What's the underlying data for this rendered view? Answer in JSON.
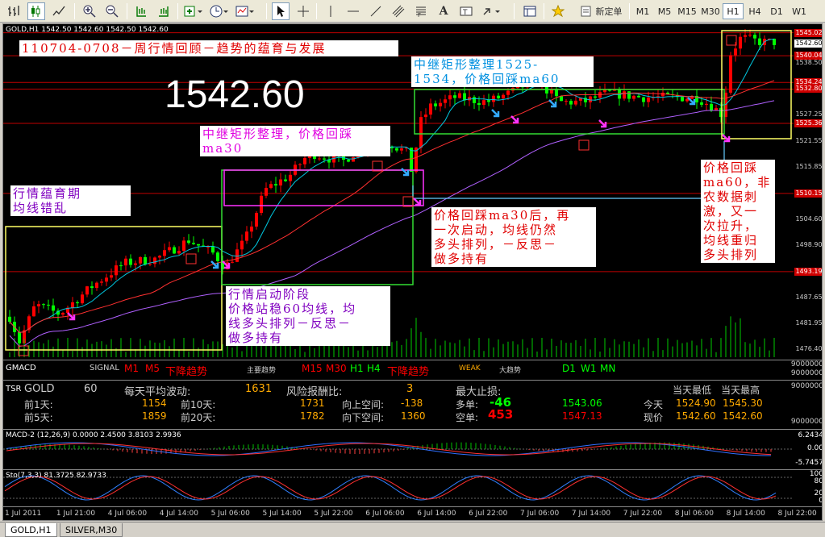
{
  "toolbar": {
    "new_order_label": "新定单",
    "timeframes": [
      "M1",
      "M5",
      "M15",
      "M30",
      "H1",
      "H4",
      "D1",
      "W1"
    ],
    "active_timeframe": "H1"
  },
  "chart": {
    "header": "GOLD,H1  1542.50 1542.60 1542.50 1542.60",
    "big_price": "1542.60",
    "price_ticks": [
      "1545.02",
      "1542.60",
      "1540.04",
      "1538.50",
      "1534.24",
      "1532.80",
      "1527.25",
      "1525.36",
      "1521.55",
      "1515.85",
      "1510.15",
      "1504.60",
      "1498.90",
      "1493.19",
      "1487.65",
      "1481.95",
      "1476.40"
    ],
    "highlighted_labels": [
      "1545.02",
      "1540.04",
      "1534.24",
      "1532.80",
      "1525.36",
      "1510.15",
      "1493.19"
    ],
    "current_label": "1542.60",
    "time_ticks": [
      "1 Jul 2011",
      "1 Jul 21:00",
      "4 Jul 06:00",
      "4 Jul 14:00",
      "5 Jul 06:00",
      "5 Jul 14:00",
      "5 Jul 22:00",
      "6 Jul 06:00",
      "6 Jul 14:00",
      "6 Jul 22:00",
      "7 Jul 06:00",
      "7 Jul 14:00",
      "7 Jul 22:00",
      "8 Jul 06:00",
      "8 Jul 14:00",
      "8 Jul 22:00"
    ],
    "annotations": {
      "title": "110704-0708－周行情回顾－趋势的蕴育与发展",
      "a1": "行情蕴育期\n均线错乱",
      "a2": "中继矩形整理，价格回踩\nma30",
      "a3": "中继矩形整理1525-\n1534，价格回踩ma60",
      "a4": "行情启动阶段\n价格站稳60均线，均\n线多头排列－反思－\n做多持有",
      "a5": "价格回踩ma30后，再\n一次启动，均线仍然\n多头排列，－反思－\n做多持有",
      "a6": "价格回踩\nma60，非\n农数据刺\n激，又一\n次拉升，\n均线重归\n多头排列"
    },
    "colors": {
      "candle_up": "#ff0000",
      "candle_down": "#00ff00",
      "ma_fast": "#00c8e0",
      "ma_mid": "#ff3030",
      "ma_slow": "#b060ff",
      "box_yellow": "#ffff66",
      "box_green": "#33dd33",
      "box_magenta": "#ff33ff"
    }
  },
  "gmacd": {
    "name": "GMACD",
    "signal_label": "SIGNAL",
    "m1": "M1",
    "m5": "M5",
    "trend1": "下降趋势",
    "main_trend": "主要趋势",
    "m15": "M15",
    "m30": "M30",
    "h1": "H1",
    "h4": "H4",
    "trend2": "下降趋势",
    "weak": "WEAK",
    "big_trend": "大趋势",
    "d1": "D1",
    "w1": "W1",
    "mn": "MN",
    "axis": [
      "9000000",
      "9000000"
    ]
  },
  "tsr": {
    "name": "TSR",
    "symbol": "GOLD",
    "period": "60",
    "avg_vol_label": "每天平均波动:",
    "avg_vol": "1631",
    "risk_label": "风险报酬比:",
    "risk": "3",
    "max_sl_label": "最大止损:",
    "today_low_label": "当天最低",
    "today_high_label": "当天最高",
    "rows": [
      {
        "l1": "前1天:",
        "v1": "1154",
        "l2": "前10天:",
        "v2": "1731",
        "l3": "向上空间:",
        "v3": "-138",
        "l4": "多单:",
        "v4": "-46",
        "v5": "1543.06",
        "l6": "今天",
        "v6": "1524.90",
        "v7": "1545.30"
      },
      {
        "l1": "前5天:",
        "v1": "1859",
        "l2": "前20天:",
        "v2": "1782",
        "l3": "向下空间:",
        "v3": "1360",
        "l4": "空单:",
        "v4": "453",
        "v5": "1547.13",
        "l6": "现价",
        "v6": "1542.60",
        "v7": "1542.60"
      }
    ],
    "axis_top": "9000000",
    "axis_bottom": "9000000"
  },
  "macd": {
    "label": "MACD-2 (12,26,9) 0.0000 2.4500 3.8103 2.9936",
    "axis": [
      "6.2434",
      "0.00",
      "-5.7457"
    ]
  },
  "sto": {
    "label": "Sto(7,3,3) 81.3725 82.9733",
    "axis": [
      "100",
      "80",
      "20",
      "0"
    ]
  },
  "tabs": [
    "GOLD,H1",
    "SILVER,M30"
  ]
}
